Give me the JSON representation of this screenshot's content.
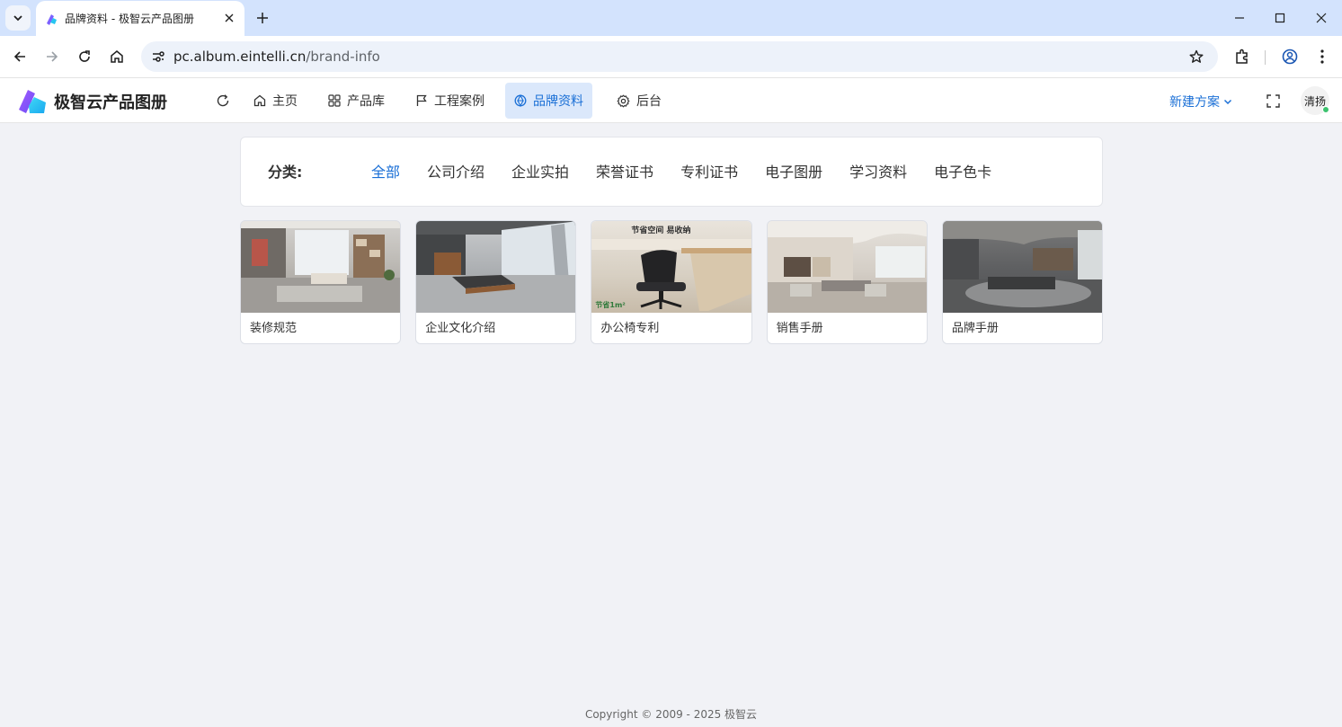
{
  "browser": {
    "tab_title": "品牌资料 - 极智云产品图册",
    "url_host": "pc.album.eintelli.cn",
    "url_path": "/brand-info"
  },
  "header": {
    "brand_name": "极智云产品图册",
    "nav": [
      {
        "label": "主页",
        "icon": "home-icon"
      },
      {
        "label": "产品库",
        "icon": "grid-icon"
      },
      {
        "label": "工程案例",
        "icon": "flag-icon"
      },
      {
        "label": "品牌资料",
        "icon": "brand-icon",
        "active": true
      },
      {
        "label": "后台",
        "icon": "gear-icon"
      }
    ],
    "new_plan_label": "新建方案",
    "user_name": "清扬",
    "accent_color": "#1a6fd6"
  },
  "filter": {
    "label": "分类:",
    "items": [
      "全部",
      "公司介绍",
      "企业实拍",
      "荣誉证书",
      "专利证书",
      "电子图册",
      "学习资料",
      "电子色卡"
    ],
    "active_index": 0
  },
  "cards": [
    {
      "title": "装修规范"
    },
    {
      "title": "企业文化介绍"
    },
    {
      "title": "办公椅专利",
      "image_text_top": "节省空间 易收纳",
      "image_text_bottom": "节省1m²"
    },
    {
      "title": "销售手册"
    },
    {
      "title": "品牌手册"
    }
  ],
  "footer": {
    "copyright": "Copyright © 2009 - 2025 极智云"
  }
}
